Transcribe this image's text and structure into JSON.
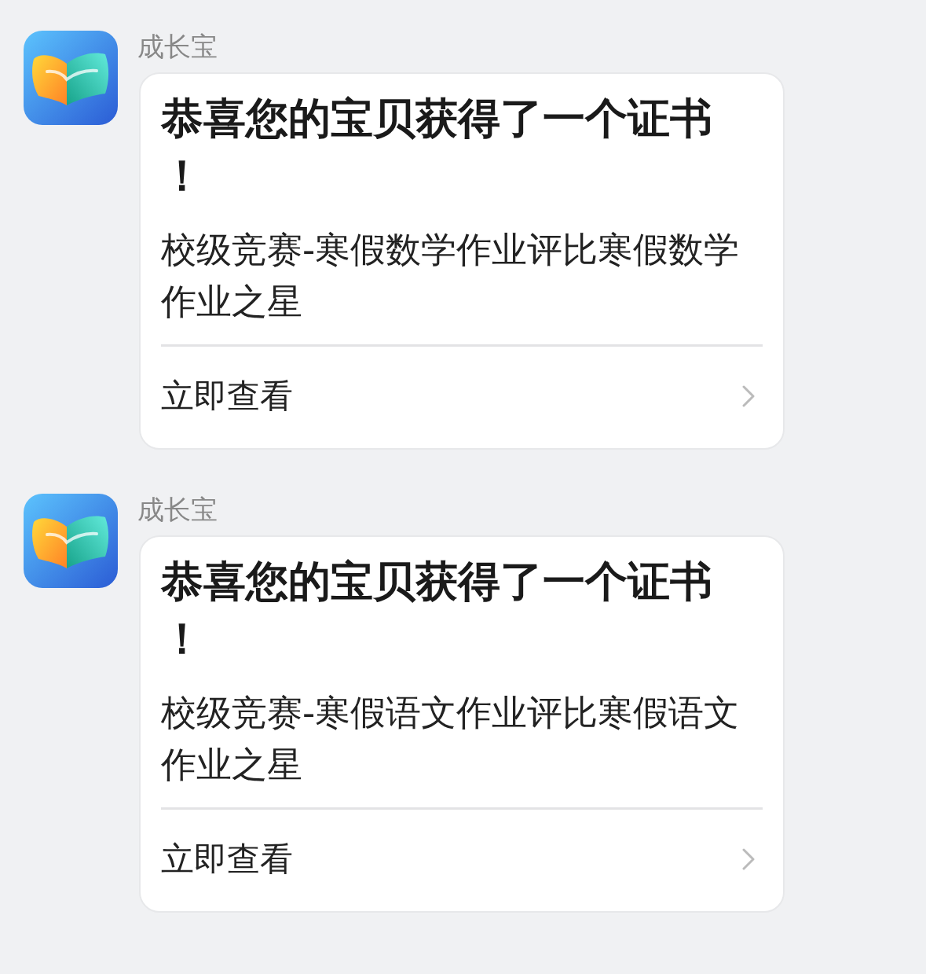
{
  "messages": [
    {
      "sender": "成长宝",
      "card": {
        "title": "恭喜您的宝贝获得了一个证书！",
        "body": "校级竞赛-寒假数学作业评比寒假数学作业之星",
        "action": "立即查看"
      }
    },
    {
      "sender": "成长宝",
      "card": {
        "title": "恭喜您的宝贝获得了一个证书！",
        "body": "校级竞赛-寒假语文作业评比寒假语文作业之星",
        "action": "立即查看"
      }
    }
  ]
}
